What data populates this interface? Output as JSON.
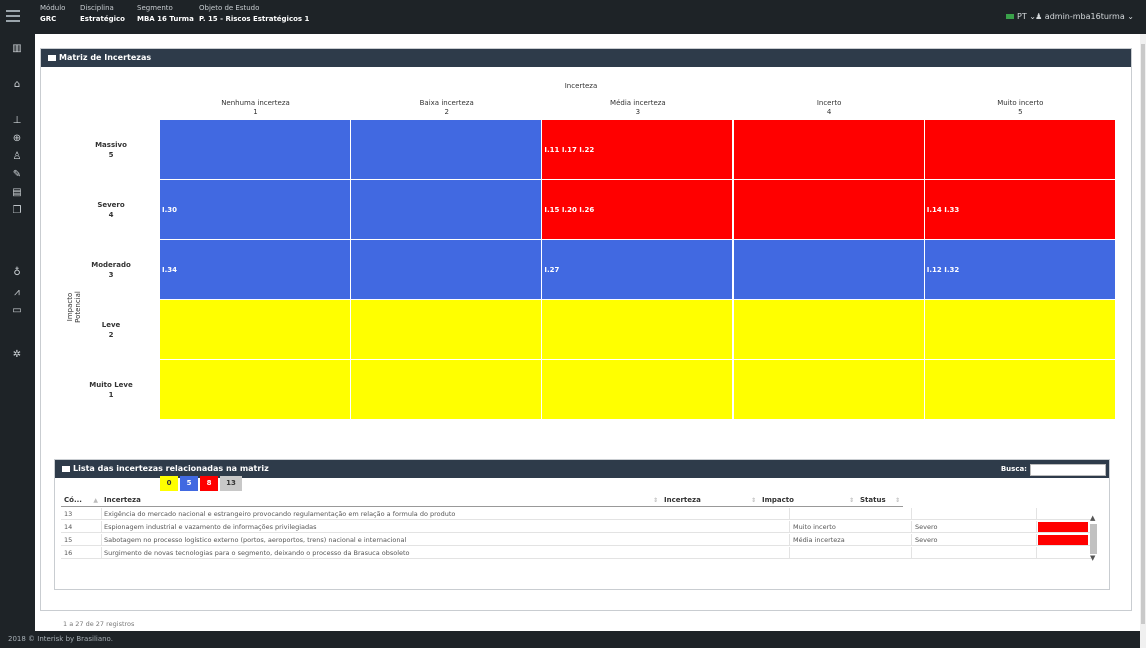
{
  "topbar": {
    "modulo_label": "Módulo",
    "modulo_value": "GRC",
    "disciplina_label": "Disciplina",
    "disciplina_value": "Estratégico",
    "segmento_label": "Segmento",
    "segmento_value": "MBA 16 Turma",
    "objeto_label": "Objeto de Estudo",
    "objeto_value": "P. 15 - Riscos Estratégicos 1",
    "lang": "PT ⌄",
    "user": "admin-mba16turma ⌄"
  },
  "sidebar": {
    "icons": [
      "bar-chart-icon",
      "home-icon",
      "org-chart-icon",
      "lock-icon",
      "user-search-icon",
      "edit-icon",
      "book-icon",
      "copy-icon",
      "bulb-icon",
      "line-chart-icon",
      "folder-icon",
      "gear-icon"
    ]
  },
  "panel": {
    "title": "Matriz de Incertezas"
  },
  "matrix": {
    "x_axis_title": "Incerteza",
    "y_axis_title": "Impacto Potencial",
    "columns": [
      {
        "label": "Nenhuma incerteza",
        "num": "1"
      },
      {
        "label": "Baixa incerteza",
        "num": "2"
      },
      {
        "label": "Média incerteza",
        "num": "3"
      },
      {
        "label": "Incerto",
        "num": "4"
      },
      {
        "label": "Muito incerto",
        "num": "5"
      }
    ],
    "rows": [
      {
        "label": "Massivo",
        "num": "5",
        "cells": [
          "",
          "",
          "I.11 I.17 I.22",
          "",
          ""
        ],
        "colors": [
          "#4169e1",
          "#4169e1",
          "#ff0000",
          "#ff0000",
          "#ff0000"
        ]
      },
      {
        "label": "Severo",
        "num": "4",
        "cells": [
          "I.30",
          "",
          "I.15 I.20 I.26",
          "",
          "I.14 I.33"
        ],
        "colors": [
          "#4169e1",
          "#4169e1",
          "#ff0000",
          "#ff0000",
          "#ff0000"
        ]
      },
      {
        "label": "Moderado",
        "num": "3",
        "cells": [
          "I.34",
          "",
          "I.27",
          "",
          "I.12 I.32"
        ],
        "colors": [
          "#4169e1",
          "#4169e1",
          "#4169e1",
          "#4169e1",
          "#4169e1"
        ]
      },
      {
        "label": "Leve",
        "num": "2",
        "cells": [
          "",
          "",
          "",
          "",
          ""
        ],
        "colors": [
          "#ffff00",
          "#ffff00",
          "#ffff00",
          "#ffff00",
          "#ffff00"
        ]
      },
      {
        "label": "Muito Leve",
        "num": "1",
        "cells": [
          "",
          "",
          "",
          "",
          ""
        ],
        "colors": [
          "#ffff00",
          "#ffff00",
          "#ffff00",
          "#ffff00",
          "#ffff00"
        ]
      }
    ],
    "legend": [
      {
        "value": "0",
        "color": "#ffff00",
        "text_color": "#333333"
      },
      {
        "value": "5",
        "color": "#4169e1",
        "text_color": "#ffffff"
      },
      {
        "value": "8",
        "color": "#ff0000",
        "text_color": "#ffffff"
      },
      {
        "value": "13",
        "color": "#c8c8c8",
        "text_color": "#333333"
      }
    ]
  },
  "list": {
    "title": "Lista das incertezas relacionadas na matriz",
    "search_label": "Busca:",
    "search_value": "",
    "columns": [
      "Có...",
      "Incerteza",
      "Incerteza",
      "Impacto",
      "Status"
    ],
    "rows": [
      {
        "code": "13",
        "desc": "Exigência do mercado nacional e estrangeiro provocando regulamentação em relação a formula do produto",
        "incerteza": "",
        "impacto": "",
        "flag": ""
      },
      {
        "code": "14",
        "desc": "Espionagem industrial e vazamento de informações privilegiadas",
        "incerteza": "Muito incerto",
        "impacto": "Severo",
        "flag": "#ff0000"
      },
      {
        "code": "15",
        "desc": "Sabotagem no processo logístico externo (portos, aeroportos, trens) nacional e internacional",
        "incerteza": "Média incerteza",
        "impacto": "Severo",
        "flag": "#ff0000"
      },
      {
        "code": "16",
        "desc": "Surgimento de novas tecnologias para o segmento, deixando o processo da Brasuca obsoleto",
        "incerteza": "",
        "impacto": "",
        "flag": ""
      }
    ],
    "records": "1 a 27 de 27 registros"
  },
  "footer": {
    "text": "2018 © Interisk by Brasiliano."
  }
}
